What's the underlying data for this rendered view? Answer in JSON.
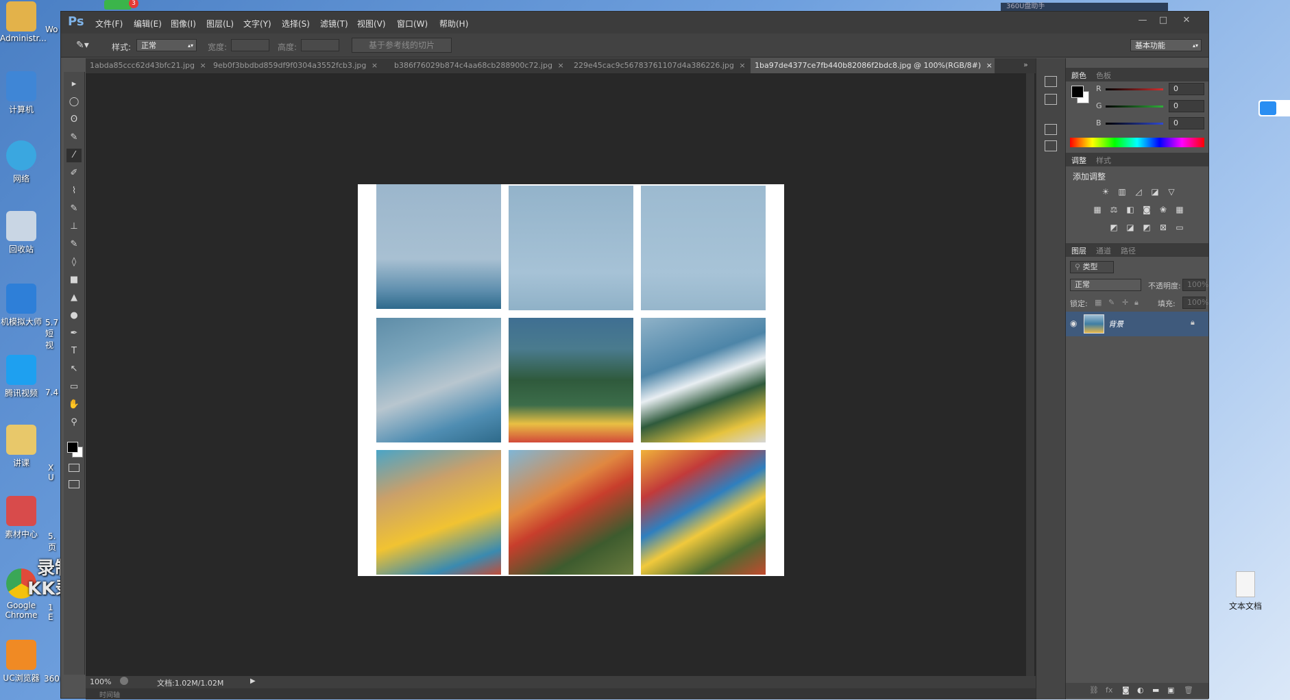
{
  "desktop": {
    "icons": [
      {
        "label": "Administr...",
        "color": "#e3b24a"
      },
      {
        "label": "计算机",
        "color": "#3f86d6"
      },
      {
        "label": "网络",
        "color": "#3aa7e0"
      },
      {
        "label": "回收站",
        "color": "#c9d6e4"
      },
      {
        "label": "机模拟大师",
        "color": "#2e7fd8"
      },
      {
        "label": "腾讯视频",
        "color": "#1ea0f0"
      },
      {
        "label": "讲课",
        "color": "#e8c86a"
      },
      {
        "label": "素材中心",
        "color": "#d84b4b"
      },
      {
        "label": "Google Chrome",
        "color": "#4caf50"
      },
      {
        "label": "UC浏览器",
        "color": "#f08a24"
      }
    ],
    "side_labels": [
      "Wo",
      "5.7 短视",
      "7.4",
      "X U",
      "5. 页",
      "1 E",
      "360"
    ],
    "right_label": "文本文档",
    "watermark_line1": "录制工具",
    "watermark_line2": "KK录像机",
    "badge": "3",
    "topbar_title": "360U盘助手"
  },
  "app": {
    "logo": "Ps",
    "menus": [
      "文件(F)",
      "编辑(E)",
      "图像(I)",
      "图层(L)",
      "文字(Y)",
      "选择(S)",
      "滤镜(T)",
      "视图(V)",
      "窗口(W)",
      "帮助(H)"
    ],
    "window_buttons": [
      "—",
      "□",
      "✕"
    ]
  },
  "options": {
    "style_label": "样式:",
    "style_value": "正常",
    "width_label": "宽度:",
    "height_label": "高度:",
    "slice_button": "基于参考线的切片",
    "workspace": "基本功能"
  },
  "tabs": [
    {
      "label": "1abda85ccc62d43bfc21.jpg",
      "close": "×"
    },
    {
      "label": "9eb0f3bbdbd859df9f0304a3552fcb3.jpg",
      "close": "×"
    },
    {
      "label": "b386f76029b874c4aa68cb288900c72.jpg",
      "close": "×"
    },
    {
      "label": "229e45cac9c56783761107d4a386226.jpg",
      "close": "×"
    },
    {
      "label": "1ba97de4377ce7fb440b82086f2bdc8.jpg @ 100%(RGB/8#)",
      "close": "×"
    }
  ],
  "tabs_more": "»",
  "tools": [
    "▸",
    "◯",
    "ʘ",
    "✎",
    "⁄",
    "✐",
    "⌇",
    "✎",
    "⊥",
    "✎",
    "◊",
    "■",
    "▲",
    "●",
    "✒",
    "T",
    "↖",
    "▭",
    "✋",
    "⚲"
  ],
  "status": {
    "zoom": "100%",
    "doc_info": "文档:1.02M/1.02M",
    "timeline": "时间轴"
  },
  "color_panel": {
    "tabs": [
      "颜色",
      "色板"
    ],
    "channels": [
      {
        "name": "R",
        "value": "0",
        "color": "#d23030"
      },
      {
        "name": "G",
        "value": "0",
        "color": "#2fae3a"
      },
      {
        "name": "B",
        "value": "0",
        "color": "#2f49d2"
      }
    ]
  },
  "adjust_panel": {
    "tabs": [
      "调整",
      "样式"
    ],
    "title": "添加调整"
  },
  "layers_panel": {
    "tabs": [
      "图层",
      "通道",
      "路径"
    ],
    "filter_label": "类型",
    "blend_mode": "正常",
    "opacity_label": "不透明度:",
    "opacity_value": "100%",
    "lock_label": "锁定:",
    "fill_label": "填充:",
    "fill_value": "100%",
    "layers": [
      {
        "name": "背景"
      }
    ]
  }
}
